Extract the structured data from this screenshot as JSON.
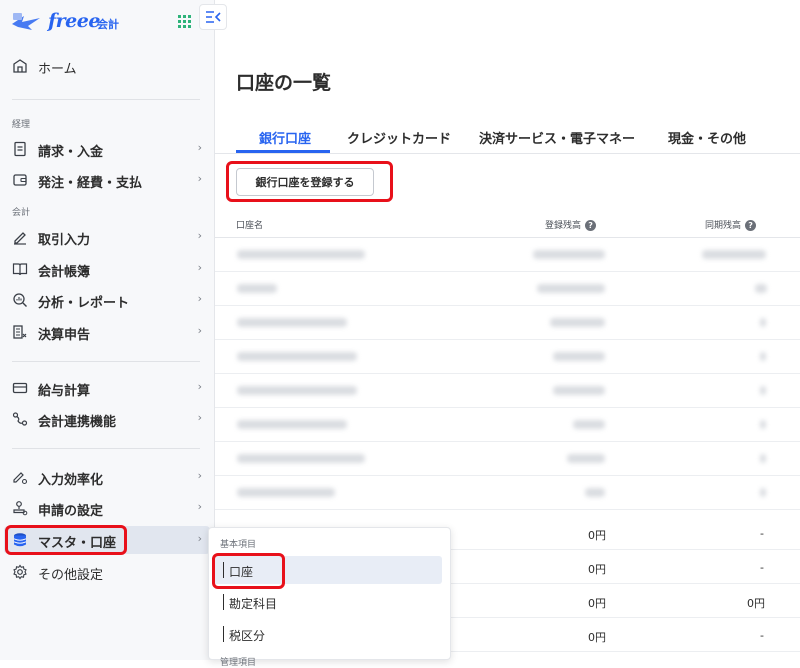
{
  "app": {
    "logo_text": "freee",
    "logo_sub": "会計"
  },
  "sidebar": {
    "home": "ホーム",
    "section_keiri": "経理",
    "section_kaikei": "会計",
    "items": [
      {
        "label": "請求・入金"
      },
      {
        "label": "発注・経費・支払"
      },
      {
        "label": "取引入力"
      },
      {
        "label": "会計帳簿"
      },
      {
        "label": "分析・レポート"
      },
      {
        "label": "決算申告"
      },
      {
        "label": "給与計算"
      },
      {
        "label": "会計連携機能"
      },
      {
        "label": "入力効率化"
      },
      {
        "label": "申請の設定"
      },
      {
        "label": "マスタ・口座"
      },
      {
        "label": "その他設定"
      }
    ],
    "chevron": "›"
  },
  "main": {
    "title": "口座の一覧",
    "tabs": [
      "銀行口座",
      "クレジットカード",
      "決済サービス・電子マネー",
      "現金・その他"
    ],
    "register_button": "銀行口座を登録する",
    "table": {
      "headers": {
        "name": "口座名",
        "registered": "登録残高",
        "synced": "同期残高"
      },
      "help_icon": "?",
      "visible_rows": [
        {
          "registered": "0円",
          "synced": "-"
        },
        {
          "registered": "0円",
          "synced": "-"
        },
        {
          "registered": "0円",
          "synced": "0円"
        },
        {
          "registered": "0円",
          "synced": "-"
        }
      ]
    }
  },
  "submenu": {
    "section": "基本項目",
    "items": [
      "口座",
      "勘定科目",
      "税区分"
    ],
    "section2": "管理項目"
  },
  "colors": {
    "accent": "#2864f0",
    "highlight": "#e8101a"
  }
}
